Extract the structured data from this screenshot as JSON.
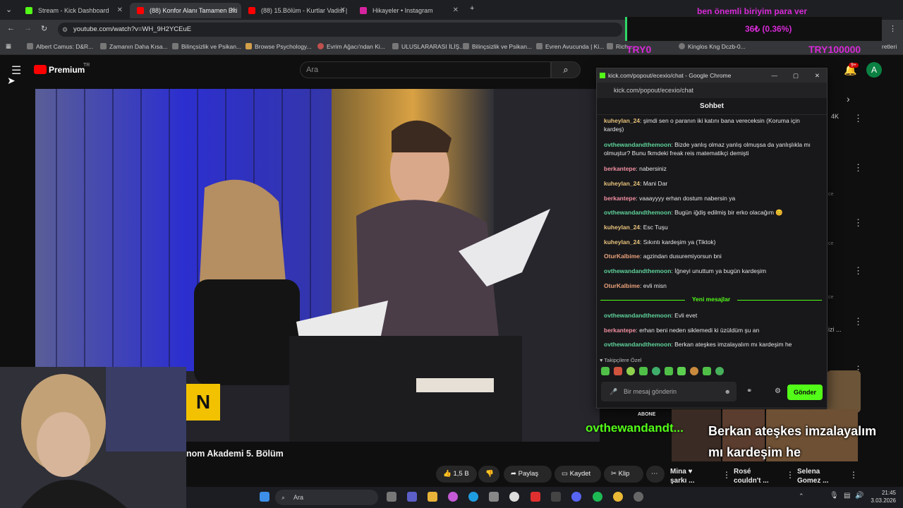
{
  "browser": {
    "tabs": [
      {
        "label": "Stream - Kick Dashboard",
        "color": "#53fc18"
      },
      {
        "label": "(88) Konfor Alanı Tamamen Biti",
        "color": "#ff0000"
      },
      {
        "label": "(88) 15.Bölüm - Kurtlar Vadisi |",
        "color": "#ff0000"
      },
      {
        "label": "Hikayeler • Instagram",
        "color": "#d6249f"
      }
    ],
    "url": "youtube.com/watch?v=WH_9H2YCEuE",
    "bookmarks": [
      "Albert Camus: D&R...",
      "Zamanın Daha Kısa...",
      "Bilinçsizlik ve Psikan...",
      "Browse Psychology...",
      "Evrim Ağacı'ndan Ki...",
      "ULUSLARARASI İLİŞ...",
      "Bilinçsizlik ve Psikan...",
      "Evren Avucunda | Ki...",
      "Rich...",
      "Kinglos Kng Dczb-0..."
    ],
    "bookmarks_extra": "retleri"
  },
  "overlay": {
    "top_text": "ben önemli biriyim para ver",
    "percent": "36₺ (0.36%)",
    "left_pink": "TRY0",
    "right_pink": "TRY100000"
  },
  "youtube": {
    "logo": "Premium",
    "logo_sup": "TR",
    "search_placeholder": "Ara",
    "notification_count": "9+",
    "avatar": "A",
    "video_title": "nom Akademi 5. Bölüm",
    "cam_badge": "N",
    "like_count": "1,5 B",
    "share": "Paylaş",
    "save": "Kaydet",
    "clip": "Klip",
    "sidebar_count": "4K",
    "recs": [
      {
        "title": "Mina ♥",
        "sub": "şarkı ..."
      },
      {
        "title": "Rosé",
        "sub": "couldn't ..."
      },
      {
        "title": "Selena",
        "sub": "Gomez ..."
      }
    ],
    "side_fragments": [
      "ce",
      "ce",
      "izi ...",
      "ce"
    ]
  },
  "popup": {
    "window_title": "kick.com/popout/ecexio/chat - Google Chrome",
    "url": "kick.com/popout/ecexio/chat",
    "header": "Sohbet",
    "messages": [
      {
        "user": "kuheylan_24",
        "text": "şimdi sen o paranın iki katını bana vereceksin (Koruma için kardeş)",
        "color": "#e8c27a"
      },
      {
        "user": "ovthewandandthemoon",
        "text": "Bizde yanlış olmaz yanlış olmuşsa da yanlışlıkla mı olmuştur? Bunu fkmdeki freak reis matematikçi demişti",
        "color": "#5fd39a"
      },
      {
        "user": "berkantepe",
        "text": "nabersiniz",
        "color": "#f28fa0"
      },
      {
        "user": "kuheylan_24",
        "text": "Mani Dar",
        "color": "#e8c27a"
      },
      {
        "user": "berkantepe",
        "text": "vaaayyyy erhan dostum nabersin ya",
        "color": "#f28fa0"
      },
      {
        "user": "ovthewandandthemoon",
        "text": "Bugün iğdiş edilmiş bir erko olacağım 😊",
        "color": "#5fd39a"
      },
      {
        "user": "kuheylan_24",
        "text": "Esc Tuşu",
        "color": "#e8c27a"
      },
      {
        "user": "kuheylan_24",
        "text": "Sıkıntı kardeşim ya (Tiktok)",
        "color": "#e8c27a"
      },
      {
        "user": "OturKalbime",
        "text": "agzindan dusuremiyorsun bni",
        "color": "#e8a07a"
      },
      {
        "user": "ovthewandandthemoon",
        "text": "İğneyi unuttum ya bugün kardeşim",
        "color": "#5fd39a"
      },
      {
        "user": "OturKalbime",
        "text": "evli misn",
        "color": "#e8a07a"
      }
    ],
    "new_messages_label": "Yeni mesajlar",
    "new_messages": [
      {
        "user": "ovthewandandthemoon",
        "text": "Evli evet",
        "color": "#5fd39a"
      },
      {
        "user": "berkantepe",
        "text": "erhan beni neden siklemedi ki üzüldüm şu an",
        "color": "#f28fa0"
      },
      {
        "user": "ovthewandandthemoon",
        "text": "Berkan ateşkes imzalayalım mı kardeşim he",
        "color": "#5fd39a"
      }
    ],
    "followers_label": "Takipçilere Özel",
    "input_placeholder": "Bir mesaj gönderin",
    "send": "Gönder"
  },
  "caption": {
    "user": "ovthewandandt...",
    "text_line1": "Berkan ateşkes imzalayalım",
    "text_line2": "mı kardeşim he",
    "abone": "ABONE"
  },
  "taskbar": {
    "search": "Ara",
    "time": "21:45",
    "date": "3.03.2026"
  }
}
